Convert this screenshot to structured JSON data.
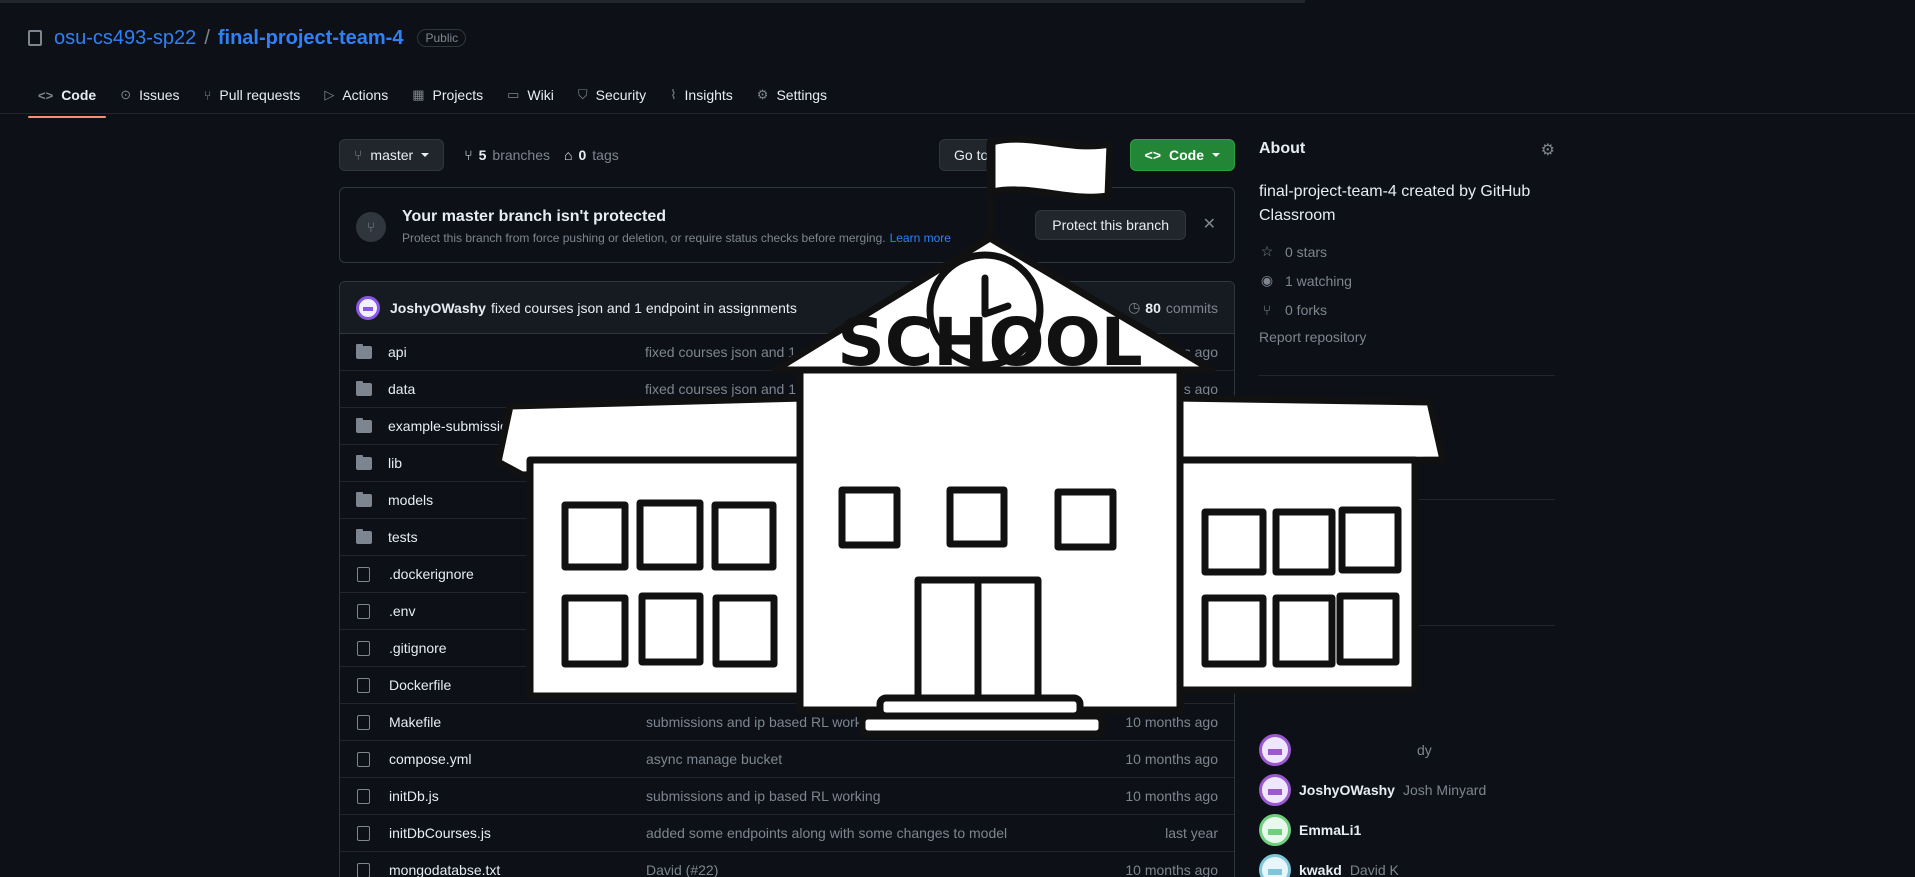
{
  "header": {
    "owner": "osu-cs493-sp22",
    "separator": "/",
    "repo": "final-project-team-4",
    "visibility": "Public"
  },
  "tabs": [
    {
      "label": "Code",
      "icon": "code-icon"
    },
    {
      "label": "Issues",
      "icon": "issue-icon"
    },
    {
      "label": "Pull requests",
      "icon": "pull-request-icon"
    },
    {
      "label": "Actions",
      "icon": "play-icon"
    },
    {
      "label": "Projects",
      "icon": "table-icon"
    },
    {
      "label": "Wiki",
      "icon": "book-icon"
    },
    {
      "label": "Security",
      "icon": "shield-icon"
    },
    {
      "label": "Insights",
      "icon": "graph-icon"
    },
    {
      "label": "Settings",
      "icon": "gear-icon"
    }
  ],
  "branch_bar": {
    "branch": "master",
    "branches_count": "5",
    "branches_label": "branches",
    "tags_count": "0",
    "tags_label": "tags",
    "goto_label": "Go to file",
    "code_label": "Code"
  },
  "protect": {
    "title": "Your master branch isn't protected",
    "desc": "Protect this branch from force pushing or deletion, or require status checks before merging.",
    "learn_more": "Learn more",
    "button": "Protect this branch",
    "close": "✕"
  },
  "latest_commit": {
    "author": "JoshyOWashy",
    "message": "fixed courses json and 1 endpoint in assignments",
    "commits_count": "80",
    "commits_label": "commits"
  },
  "files": [
    {
      "type": "dir",
      "name": "api",
      "message": "fixed courses json and 1",
      "age": "months ago"
    },
    {
      "type": "dir",
      "name": "data",
      "message": "fixed courses json and 1",
      "age": "months ago"
    },
    {
      "type": "dir",
      "name": "example-submission",
      "message": "",
      "age": ""
    },
    {
      "type": "dir",
      "name": "lib",
      "message": "",
      "age": ""
    },
    {
      "type": "dir",
      "name": "models",
      "message": "",
      "age": ""
    },
    {
      "type": "dir",
      "name": "tests",
      "message": "",
      "age": ""
    },
    {
      "type": "file",
      "name": ".dockerignore",
      "message": "",
      "age": ""
    },
    {
      "type": "file",
      "name": ".env",
      "message": "",
      "age": ""
    },
    {
      "type": "file",
      "name": ".gitignore",
      "message": "",
      "age": ""
    },
    {
      "type": "file",
      "name": "Dockerfile",
      "message": "",
      "age": ""
    },
    {
      "type": "file",
      "name": "Makefile",
      "message": "submissions and ip based RL working",
      "age": "10 months ago"
    },
    {
      "type": "file",
      "name": "compose.yml",
      "message": "async manage bucket",
      "age": "10 months ago"
    },
    {
      "type": "file",
      "name": "initDb.js",
      "message": "submissions and ip based RL working",
      "age": "10 months ago"
    },
    {
      "type": "file",
      "name": "initDbCourses.js",
      "message": "added some endpoints along with some changes to model",
      "age": "last year"
    },
    {
      "type": "file",
      "name": "mongodatabse.txt",
      "message": "David (#22)",
      "age": "10 months ago"
    }
  ],
  "about": {
    "title": "About",
    "description": "final-project-team-4 created by GitHub Classroom",
    "stars": "0 stars",
    "watching": "1 watching",
    "forks": "0 forks",
    "report": "Report repository"
  },
  "contributors": [
    {
      "login": "",
      "name": "dy",
      "color": "purple"
    },
    {
      "login": "JoshyOWashy",
      "name": "Josh Minyard",
      "color": "purple"
    },
    {
      "login": "EmmaLi1",
      "name": "",
      "color": "green"
    },
    {
      "login": "kwakd",
      "name": "David K",
      "color": "teal"
    }
  ],
  "overlay": {
    "sign_text": "SCHOOL"
  },
  "colors": {
    "background": "#0d1117",
    "link": "#2f81f7",
    "code_button": "#238636",
    "active_tab": "#fd8c73"
  }
}
